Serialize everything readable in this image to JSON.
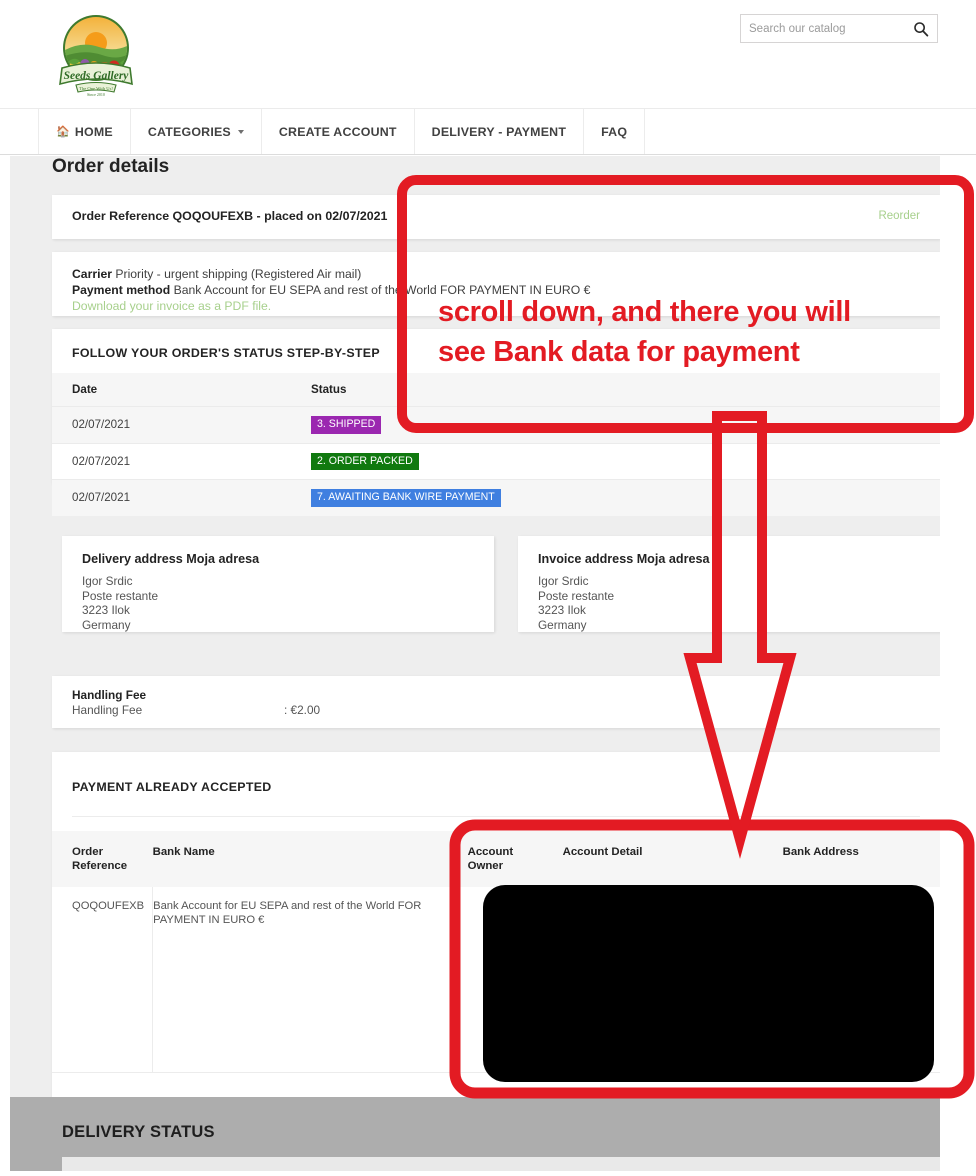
{
  "header": {
    "logo_alt": "Seeds Gallery",
    "search": {
      "placeholder": "Search our catalog",
      "value": "",
      "icon": "search-icon"
    }
  },
  "nav": {
    "items": [
      {
        "label": "HOME",
        "icon": "home-icon",
        "has_caret": false
      },
      {
        "label": "CATEGORIES",
        "icon": "",
        "has_caret": true
      },
      {
        "label": "CREATE ACCOUNT",
        "icon": "",
        "has_caret": false
      },
      {
        "label": "DELIVERY - PAYMENT",
        "icon": "",
        "has_caret": false
      },
      {
        "label": "FAQ",
        "icon": "",
        "has_caret": false
      }
    ]
  },
  "page": {
    "title": "Order details"
  },
  "order_reference": {
    "text": "Order Reference QOQOUFEXB - placed on 02/07/2021",
    "reorder_label": "Reorder"
  },
  "carrier": {
    "carrier_label": "Carrier",
    "carrier_value": "Priority - urgent shipping (Registered Air mail)",
    "payment_label": "Payment method",
    "payment_value": "Bank Account for EU SEPA and rest of the World FOR PAYMENT IN EURO €",
    "invoice_link": "Download your invoice as a PDF file."
  },
  "status": {
    "heading": "FOLLOW YOUR ORDER'S STATUS STEP-BY-STEP",
    "columns": [
      "Date",
      "Status"
    ],
    "rows": [
      {
        "date": "02/07/2021",
        "status": "3. SHIPPED",
        "color": "#9b27b0"
      },
      {
        "date": "02/07/2021",
        "status": "2. ORDER PACKED",
        "color": "#10790f"
      },
      {
        "date": "02/07/2021",
        "status": "7. AWAITING BANK WIRE PAYMENT",
        "color": "#3f7fe0"
      }
    ]
  },
  "delivery_address": {
    "title": "Delivery address Moja adresa",
    "lines": [
      "Igor Srdic",
      "Poste restante",
      "3223 Ilok",
      "Germany"
    ]
  },
  "invoice_address": {
    "title": "Invoice address Moja adresa",
    "lines": [
      "Igor Srdic",
      "Poste restante",
      "3223 Ilok",
      "Germany"
    ]
  },
  "handling_fee": {
    "title": "Handling Fee",
    "label": "Handling Fee",
    "amount": ": €2.00"
  },
  "payment_accepted": {
    "heading": "PAYMENT ALREADY ACCEPTED",
    "columns": [
      "Order Reference",
      "Bank Name",
      "Account Owner",
      "Account Detail",
      "Bank Address"
    ],
    "rows": [
      {
        "order_reference": "QOQOUFEXB",
        "bank_name": "Bank Account for EU SEPA and rest of the World FOR PAYMENT IN EURO €",
        "account_owner": "",
        "account_detail": "",
        "bank_address": ""
      }
    ],
    "redacted": true
  },
  "delivery_status": {
    "heading": "DELIVERY STATUS"
  },
  "annotations": {
    "color": "#e31b23",
    "note_line1": "scroll down, and there you will",
    "note_line2": "see Bank data for payment",
    "shapes": [
      "highlight-box-top",
      "down-arrow",
      "highlight-box-bottom"
    ]
  }
}
